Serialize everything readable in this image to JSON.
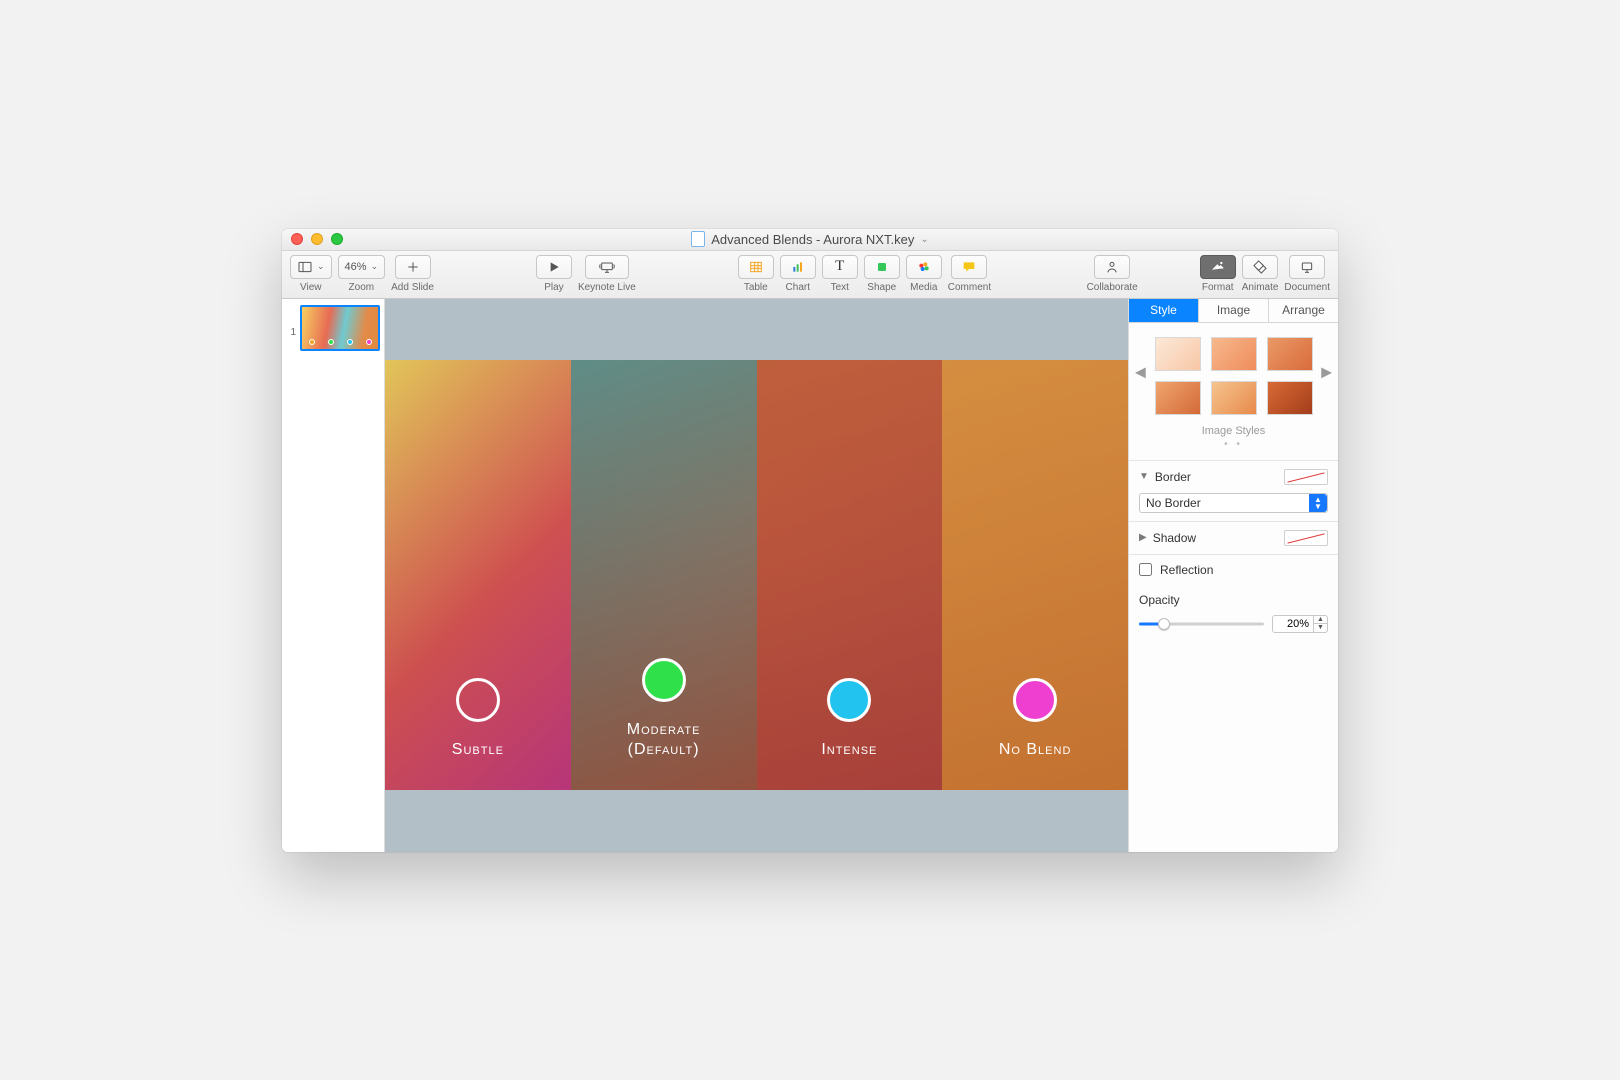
{
  "window": {
    "title": "Advanced Blends - Aurora NXT.key"
  },
  "toolbar": {
    "view": "View",
    "zoom": {
      "label": "Zoom",
      "value": "46%"
    },
    "addSlide": "Add Slide",
    "play": "Play",
    "keynoteLive": "Keynote Live",
    "table": "Table",
    "chart": "Chart",
    "text": "Text",
    "shape": "Shape",
    "media": "Media",
    "comment": "Comment",
    "collaborate": "Collaborate",
    "format": "Format",
    "animate": "Animate",
    "document": "Document"
  },
  "navigator": {
    "slides": [
      {
        "number": "1"
      }
    ]
  },
  "slide": {
    "items": [
      {
        "label": "Subtle",
        "color": "#f5a623"
      },
      {
        "label": "Moderate\n(Default)",
        "color": "#2fe04a"
      },
      {
        "label": "Intense",
        "color": "#22c3ef"
      },
      {
        "label": "No Blend",
        "color": "#ef3fd0"
      }
    ]
  },
  "inspector": {
    "tabs": {
      "style": "Style",
      "image": "Image",
      "arrange": "Arrange",
      "active": "style"
    },
    "imageStyles": {
      "title": "Image Styles"
    },
    "border": {
      "title": "Border",
      "value": "No Border"
    },
    "shadow": {
      "title": "Shadow"
    },
    "reflection": {
      "title": "Reflection",
      "checked": false
    },
    "opacity": {
      "title": "Opacity",
      "value": "20%",
      "percent": 20
    }
  }
}
